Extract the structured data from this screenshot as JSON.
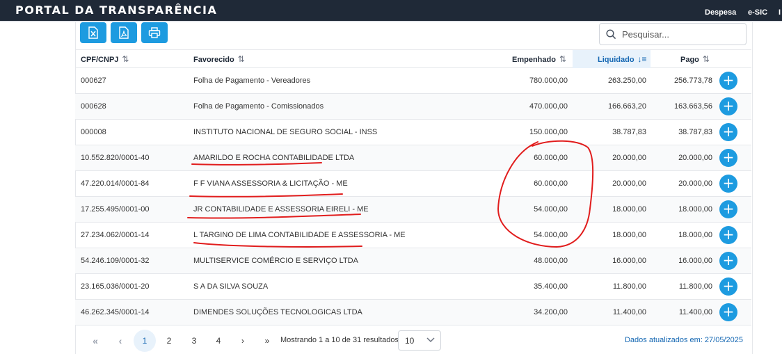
{
  "header": {
    "brand": "PORTAL DA TRANSPARÊNCIA",
    "nav": [
      "Despesa",
      "e-SIC",
      "I"
    ]
  },
  "toolbar": {
    "icons": [
      "excel-export-icon",
      "pdf-export-icon",
      "print-icon"
    ]
  },
  "search": {
    "placeholder": "Pesquisar..."
  },
  "table": {
    "columns": [
      {
        "label": "CPF/CNPJ",
        "sort": "⇅"
      },
      {
        "label": "Favorecido",
        "sort": "⇅"
      },
      {
        "label": "Empenhado",
        "sort": "⇅"
      },
      {
        "label": "Liquidado",
        "sort": "↓≡"
      },
      {
        "label": "Pago",
        "sort": "⇅"
      }
    ],
    "rows": [
      {
        "cpf": "000627",
        "favorecido": "Folha de Pagamento - Vereadores",
        "empenhado": "780.000,00",
        "liquidado": "263.250,00",
        "pago": "256.773,78"
      },
      {
        "cpf": "000628",
        "favorecido": "Folha de Pagamento - Comissionados",
        "empenhado": "470.000,00",
        "liquidado": "166.663,20",
        "pago": "163.663,56"
      },
      {
        "cpf": "000008",
        "favorecido": "INSTITUTO NACIONAL DE SEGURO SOCIAL - INSS",
        "empenhado": "150.000,00",
        "liquidado": "38.787,83",
        "pago": "38.787,83"
      },
      {
        "cpf": "10.552.820/0001-40",
        "favorecido": "AMARILDO E ROCHA CONTABILIDADE LTDA",
        "empenhado": "60.000,00",
        "liquidado": "20.000,00",
        "pago": "20.000,00"
      },
      {
        "cpf": "47.220.014/0001-84",
        "favorecido": "F F VIANA ASSESSORIA & LICITAÇÃO - ME",
        "empenhado": "60.000,00",
        "liquidado": "20.000,00",
        "pago": "20.000,00"
      },
      {
        "cpf": "17.255.495/0001-00",
        "favorecido": "JR CONTABILIDADE E ASSESSORIA EIRELI - ME",
        "empenhado": "54.000,00",
        "liquidado": "18.000,00",
        "pago": "18.000,00"
      },
      {
        "cpf": "27.234.062/0001-14",
        "favorecido": "L TARGINO DE LIMA CONTABILIDADE E ASSESSORIA - ME",
        "empenhado": "54.000,00",
        "liquidado": "18.000,00",
        "pago": "18.000,00"
      },
      {
        "cpf": "54.246.109/0001-32",
        "favorecido": "MULTISERVICE COMÉRCIO E SERVIÇO LTDA",
        "empenhado": "48.000,00",
        "liquidado": "16.000,00",
        "pago": "16.000,00"
      },
      {
        "cpf": "23.165.036/0001-20",
        "favorecido": "S A DA SILVA SOUZA",
        "empenhado": "35.400,00",
        "liquidado": "11.800,00",
        "pago": "11.800,00"
      },
      {
        "cpf": "46.262.345/0001-14",
        "favorecido": "DIMENDES SOLUÇÕES TECNOLOGICAS LTDA",
        "empenhado": "34.200,00",
        "liquidado": "11.400,00",
        "pago": "11.400,00"
      }
    ],
    "row_action": "+"
  },
  "pagination": {
    "first": "«",
    "prev": "‹",
    "pages": [
      "1",
      "2",
      "3",
      "4"
    ],
    "current": "1",
    "next": "›",
    "last": "»",
    "result_text": "Mostrando 1 a 10 de 31 resultados",
    "page_size": "10"
  },
  "footer": {
    "updated": "Dados atualizados em: 27/05/2025"
  },
  "colors": {
    "accent": "#1d9be0",
    "link": "#1668b3",
    "annotation": "#e11d1d",
    "header_bg": "#1f2937"
  }
}
